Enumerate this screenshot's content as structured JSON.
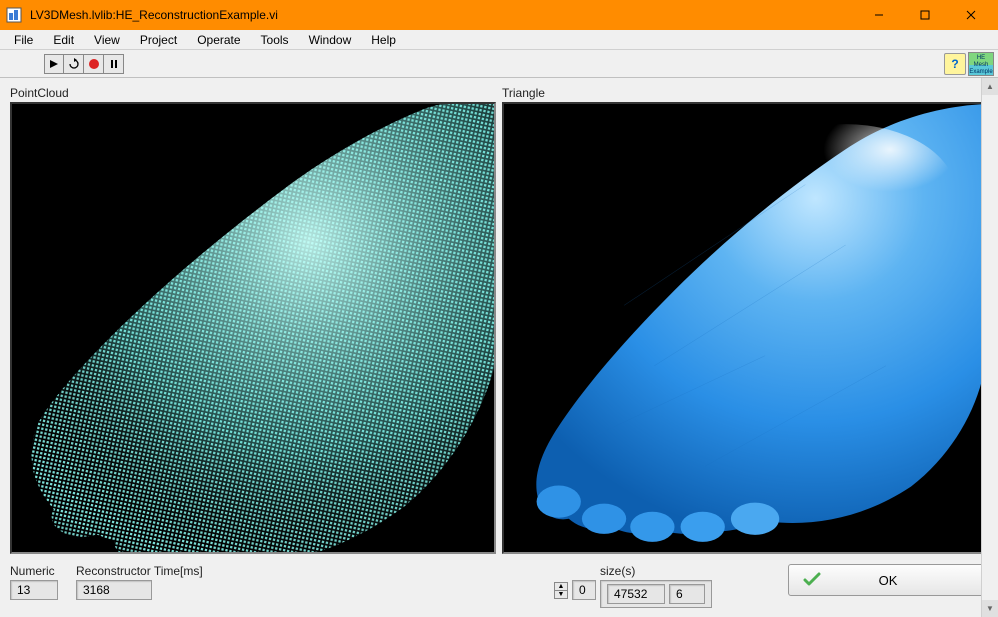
{
  "window": {
    "title": "LV3DMesh.lvlib:HE_ReconstructionExample.vi"
  },
  "menu": {
    "items": [
      "File",
      "Edit",
      "View",
      "Project",
      "Operate",
      "Tools",
      "Window",
      "Help"
    ]
  },
  "toolbar": {
    "help_tooltip": "?",
    "badge_line1": "HE",
    "badge_line2": "Mesh",
    "badge_line3": "Example"
  },
  "viewports": {
    "left_label": "PointCloud",
    "right_label": "Triangle"
  },
  "controls": {
    "numeric_label": "Numeric",
    "numeric_value": "13",
    "recon_label": "Reconstructor Time[ms]",
    "recon_value": "3168",
    "index_value": "0",
    "sizes_label": "size(s)",
    "size_a": "47532",
    "size_b": "6",
    "ok_label": "OK"
  }
}
